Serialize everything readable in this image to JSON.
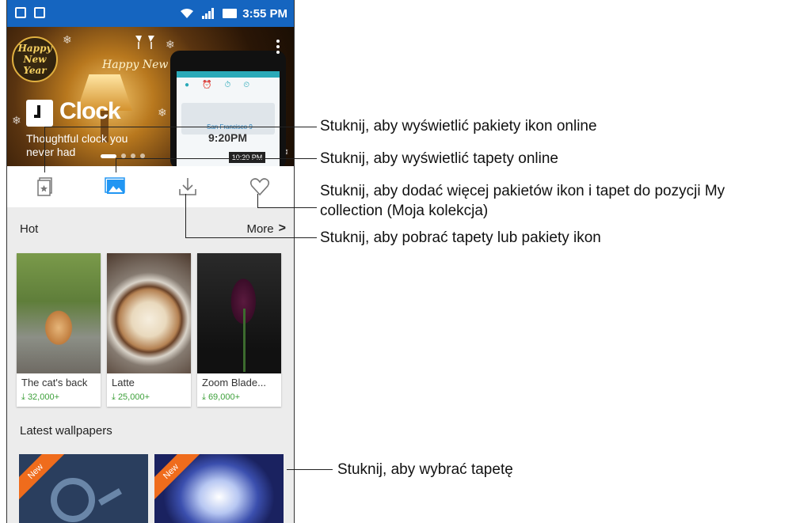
{
  "status_bar": {
    "time": "3:55 PM"
  },
  "banner": {
    "logo_line1": "Happy",
    "logo_line2": "New",
    "logo_line3": "Year",
    "greeting": "Happy New Year",
    "app_title": "Clock",
    "description": "Thoughtful clock you never had",
    "phone_city": "San Francisco 9",
    "phone_time": "9:20PM",
    "timebox": "10:20 PM"
  },
  "tabs": [
    {
      "name": "icon-packs"
    },
    {
      "name": "wallpapers",
      "active": true
    },
    {
      "name": "download"
    },
    {
      "name": "my-collection"
    }
  ],
  "hot": {
    "title": "Hot",
    "more_label": "More",
    "items": [
      {
        "name": "The cat's back",
        "count": "32,000+"
      },
      {
        "name": "Latte",
        "count": "25,000+"
      },
      {
        "name": "Zoom Blade...",
        "count": "69,000+"
      }
    ]
  },
  "latest": {
    "title": "Latest wallpapers",
    "items": [
      {
        "badge": "New"
      },
      {
        "badge": "New"
      }
    ]
  },
  "callouts": {
    "icon_packs": "Stuknij, aby wyświetlić pakiety ikon online",
    "wallpapers": "Stuknij, aby wyświetlić tapety online",
    "collection_line1": "Stuknij, aby dodać więcej pakietów ikon i tapet do pozycji My",
    "collection_line2": "collection (Moja kolekcja)",
    "download": "Stuknij, aby pobrać tapety lub pakiety ikon",
    "select_wallpaper": "Stuknij, aby wybrać tapetę"
  },
  "colors": {
    "status_bar": "#1565c0",
    "accent_blue": "#2196f3",
    "download_green": "#3da03a",
    "new_badge": "#ef6c1c"
  }
}
